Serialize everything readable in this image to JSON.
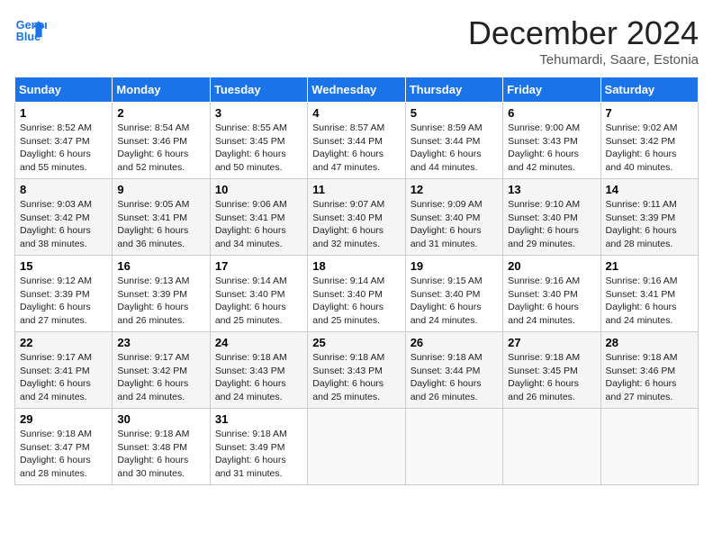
{
  "header": {
    "logo_line1": "General",
    "logo_line2": "Blue",
    "month": "December 2024",
    "location": "Tehumardi, Saare, Estonia"
  },
  "weekdays": [
    "Sunday",
    "Monday",
    "Tuesday",
    "Wednesday",
    "Thursday",
    "Friday",
    "Saturday"
  ],
  "weeks": [
    [
      {
        "day": "1",
        "rise": "8:52 AM",
        "set": "3:47 PM",
        "daylight": "6 hours and 55 minutes."
      },
      {
        "day": "2",
        "rise": "8:54 AM",
        "set": "3:46 PM",
        "daylight": "6 hours and 52 minutes."
      },
      {
        "day": "3",
        "rise": "8:55 AM",
        "set": "3:45 PM",
        "daylight": "6 hours and 50 minutes."
      },
      {
        "day": "4",
        "rise": "8:57 AM",
        "set": "3:44 PM",
        "daylight": "6 hours and 47 minutes."
      },
      {
        "day": "5",
        "rise": "8:59 AM",
        "set": "3:44 PM",
        "daylight": "6 hours and 44 minutes."
      },
      {
        "day": "6",
        "rise": "9:00 AM",
        "set": "3:43 PM",
        "daylight": "6 hours and 42 minutes."
      },
      {
        "day": "7",
        "rise": "9:02 AM",
        "set": "3:42 PM",
        "daylight": "6 hours and 40 minutes."
      }
    ],
    [
      {
        "day": "8",
        "rise": "9:03 AM",
        "set": "3:42 PM",
        "daylight": "6 hours and 38 minutes."
      },
      {
        "day": "9",
        "rise": "9:05 AM",
        "set": "3:41 PM",
        "daylight": "6 hours and 36 minutes."
      },
      {
        "day": "10",
        "rise": "9:06 AM",
        "set": "3:41 PM",
        "daylight": "6 hours and 34 minutes."
      },
      {
        "day": "11",
        "rise": "9:07 AM",
        "set": "3:40 PM",
        "daylight": "6 hours and 32 minutes."
      },
      {
        "day": "12",
        "rise": "9:09 AM",
        "set": "3:40 PM",
        "daylight": "6 hours and 31 minutes."
      },
      {
        "day": "13",
        "rise": "9:10 AM",
        "set": "3:40 PM",
        "daylight": "6 hours and 29 minutes."
      },
      {
        "day": "14",
        "rise": "9:11 AM",
        "set": "3:39 PM",
        "daylight": "6 hours and 28 minutes."
      }
    ],
    [
      {
        "day": "15",
        "rise": "9:12 AM",
        "set": "3:39 PM",
        "daylight": "6 hours and 27 minutes."
      },
      {
        "day": "16",
        "rise": "9:13 AM",
        "set": "3:39 PM",
        "daylight": "6 hours and 26 minutes."
      },
      {
        "day": "17",
        "rise": "9:14 AM",
        "set": "3:40 PM",
        "daylight": "6 hours and 25 minutes."
      },
      {
        "day": "18",
        "rise": "9:14 AM",
        "set": "3:40 PM",
        "daylight": "6 hours and 25 minutes."
      },
      {
        "day": "19",
        "rise": "9:15 AM",
        "set": "3:40 PM",
        "daylight": "6 hours and 24 minutes."
      },
      {
        "day": "20",
        "rise": "9:16 AM",
        "set": "3:40 PM",
        "daylight": "6 hours and 24 minutes."
      },
      {
        "day": "21",
        "rise": "9:16 AM",
        "set": "3:41 PM",
        "daylight": "6 hours and 24 minutes."
      }
    ],
    [
      {
        "day": "22",
        "rise": "9:17 AM",
        "set": "3:41 PM",
        "daylight": "6 hours and 24 minutes."
      },
      {
        "day": "23",
        "rise": "9:17 AM",
        "set": "3:42 PM",
        "daylight": "6 hours and 24 minutes."
      },
      {
        "day": "24",
        "rise": "9:18 AM",
        "set": "3:43 PM",
        "daylight": "6 hours and 24 minutes."
      },
      {
        "day": "25",
        "rise": "9:18 AM",
        "set": "3:43 PM",
        "daylight": "6 hours and 25 minutes."
      },
      {
        "day": "26",
        "rise": "9:18 AM",
        "set": "3:44 PM",
        "daylight": "6 hours and 26 minutes."
      },
      {
        "day": "27",
        "rise": "9:18 AM",
        "set": "3:45 PM",
        "daylight": "6 hours and 26 minutes."
      },
      {
        "day": "28",
        "rise": "9:18 AM",
        "set": "3:46 PM",
        "daylight": "6 hours and 27 minutes."
      }
    ],
    [
      {
        "day": "29",
        "rise": "9:18 AM",
        "set": "3:47 PM",
        "daylight": "6 hours and 28 minutes."
      },
      {
        "day": "30",
        "rise": "9:18 AM",
        "set": "3:48 PM",
        "daylight": "6 hours and 30 minutes."
      },
      {
        "day": "31",
        "rise": "9:18 AM",
        "set": "3:49 PM",
        "daylight": "6 hours and 31 minutes."
      },
      null,
      null,
      null,
      null
    ]
  ]
}
